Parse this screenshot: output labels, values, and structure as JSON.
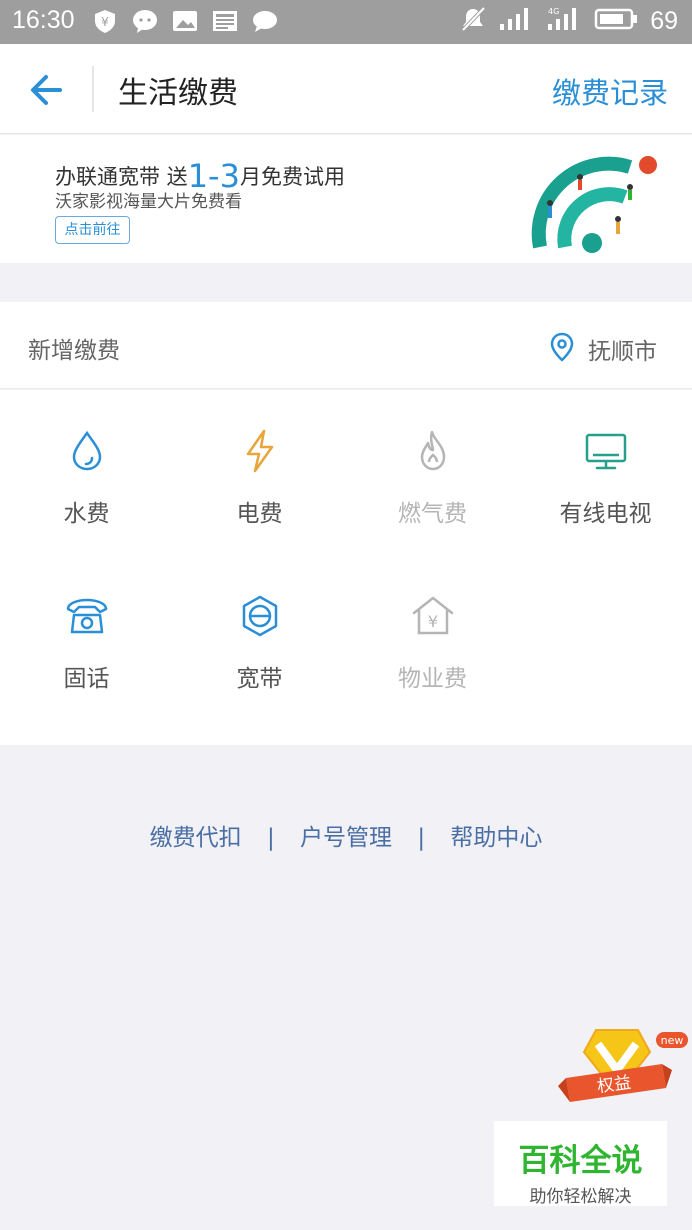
{
  "status": {
    "time": "16:30",
    "battery": "69"
  },
  "header": {
    "title": "生活缴费",
    "records_link": "缴费记录"
  },
  "banner": {
    "line1_prefix": "办联通宽带  送",
    "line1_highlight": "1-3",
    "line1_suffix": "月免费试用",
    "line2": "沃家影视海量大片免费看",
    "button": "点击前往"
  },
  "location": {
    "label": "新增缴费",
    "city": "抚顺市"
  },
  "services": [
    {
      "label": "水费",
      "icon": "water-drop-icon",
      "color": "#2a8fd6",
      "enabled": true
    },
    {
      "label": "电费",
      "icon": "lightning-icon",
      "color": "#e7a53a",
      "enabled": true
    },
    {
      "label": "燃气费",
      "icon": "flame-icon",
      "color": "#b5b5b5",
      "enabled": false
    },
    {
      "label": "有线电视",
      "icon": "tv-icon",
      "color": "#26a08a",
      "enabled": true
    },
    {
      "label": "固话",
      "icon": "telephone-icon",
      "color": "#2a8fd6",
      "enabled": true
    },
    {
      "label": "宽带",
      "icon": "broadband-icon",
      "color": "#2a8fd6",
      "enabled": true
    },
    {
      "label": "物业费",
      "icon": "house-yuan-icon",
      "color": "#b5b5b5",
      "enabled": false
    }
  ],
  "footer_links": [
    "缴费代扣",
    "户号管理",
    "帮助中心"
  ],
  "badge": {
    "label": "权益",
    "tag": "new"
  },
  "watermark": {
    "title": "百科全说",
    "subtitle": "助你轻松解决"
  }
}
